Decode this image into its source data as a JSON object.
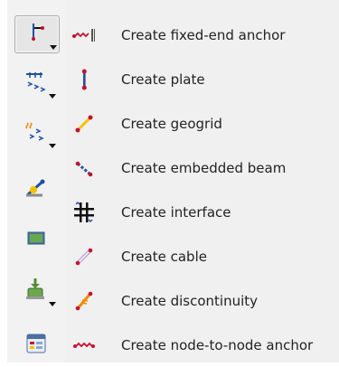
{
  "toolbar": {
    "tools": [
      {
        "icon": "fixed-end-anchor-tool-icon",
        "active": true,
        "has_dropdown": true
      },
      {
        "icon": "distributed-load-tool-icon",
        "active": false,
        "has_dropdown": true
      },
      {
        "icon": "point-load-tool-icon",
        "active": false,
        "has_dropdown": true
      },
      {
        "icon": "structure-tool-icon",
        "active": false,
        "has_dropdown": false
      },
      {
        "icon": "soil-cluster-tool-icon",
        "active": false,
        "has_dropdown": false
      },
      {
        "icon": "boundary-condition-tool-icon",
        "active": false,
        "has_dropdown": true
      },
      {
        "icon": "table-tool-icon",
        "active": false,
        "has_dropdown": false
      }
    ]
  },
  "menu": {
    "items": [
      {
        "label": "Create fixed-end anchor",
        "icon": "fixed-end-anchor-icon"
      },
      {
        "label": "Create plate",
        "icon": "plate-icon"
      },
      {
        "label": "Create geogrid",
        "icon": "geogrid-icon"
      },
      {
        "label": "Create embedded beam",
        "icon": "embedded-beam-icon"
      },
      {
        "label": "Create interface",
        "icon": "interface-icon"
      },
      {
        "label": "Create cable",
        "icon": "cable-icon"
      },
      {
        "label": "Create discontinuity",
        "icon": "discontinuity-icon"
      },
      {
        "label": "Create node-to-node anchor",
        "icon": "node-to-node-anchor-icon"
      }
    ]
  },
  "colors": {
    "menu_bg": "#f0f0f0",
    "toolbar_bg": "#f2f2f2",
    "accent_red": "#c8102e",
    "accent_blue": "#1f4fa3",
    "accent_yellow": "#f2c300",
    "accent_green": "#4f8f2f"
  }
}
